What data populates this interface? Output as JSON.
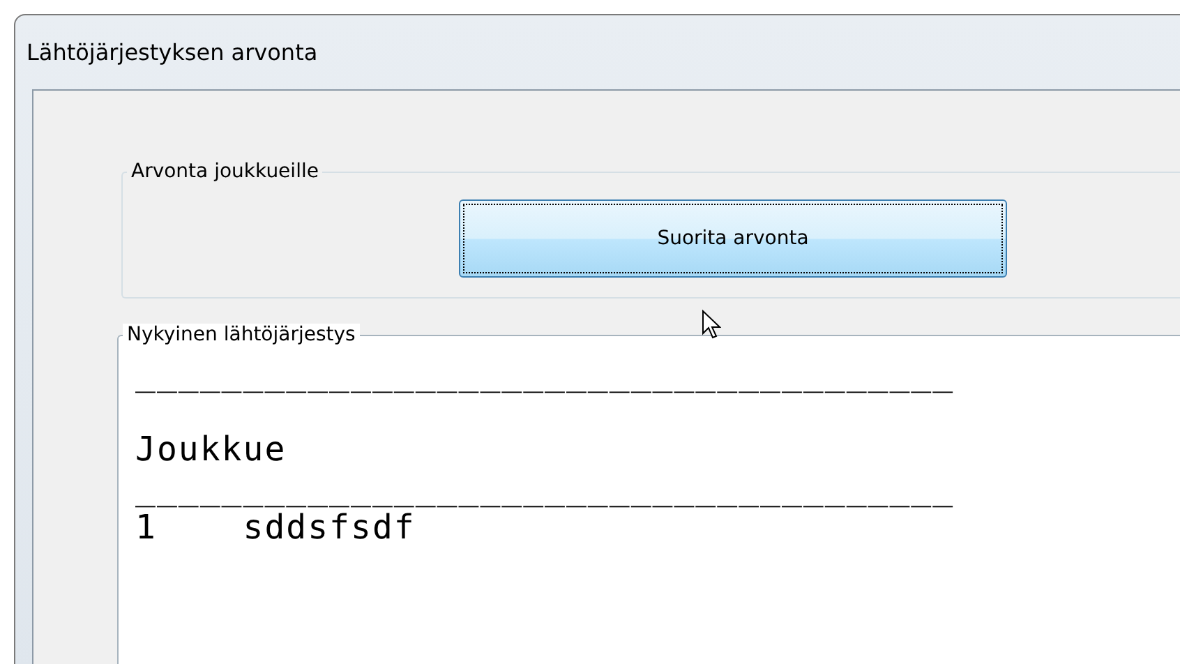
{
  "window": {
    "title": "Lähtöjärjestyksen arvonta"
  },
  "draw_group": {
    "label": "Arvonta joukkueille",
    "button": {
      "label": "Suorita arvonta",
      "focused": true
    }
  },
  "order_group": {
    "label": "Nykyinen lähtöjärjestys",
    "lines": [
      {
        "kind": "text",
        "text": "______________________________________"
      },
      {
        "kind": "blank"
      },
      {
        "kind": "text",
        "text": "Joukkue"
      },
      {
        "kind": "text",
        "text": "______________________________________"
      },
      {
        "kind": "text",
        "text": "1    sddsfsdf"
      }
    ]
  }
}
